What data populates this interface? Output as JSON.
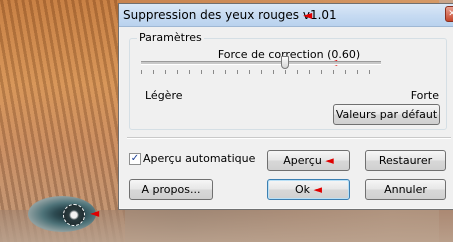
{
  "window": {
    "title": "Suppression des yeux rouges v1.01",
    "close_glyph": "✕"
  },
  "params": {
    "group_label": "Paramètres",
    "slider_label": "Force de correction (0.60)",
    "slider_value": 0.6,
    "min_label": "Légère",
    "max_label": "Forte",
    "defaults_button": "Valeurs par défaut"
  },
  "preview": {
    "auto_label": "Aperçu automatique",
    "auto_checked": true,
    "check_glyph": "✓",
    "apercu_button": "Aperçu",
    "restore_button": "Restaurer"
  },
  "actions": {
    "about_button": "A propos...",
    "ok_button": "Ok",
    "cancel_button": "Annuler"
  },
  "annotations": {
    "arrow_glyph": "◄",
    "arrow_color": "#e00000"
  }
}
